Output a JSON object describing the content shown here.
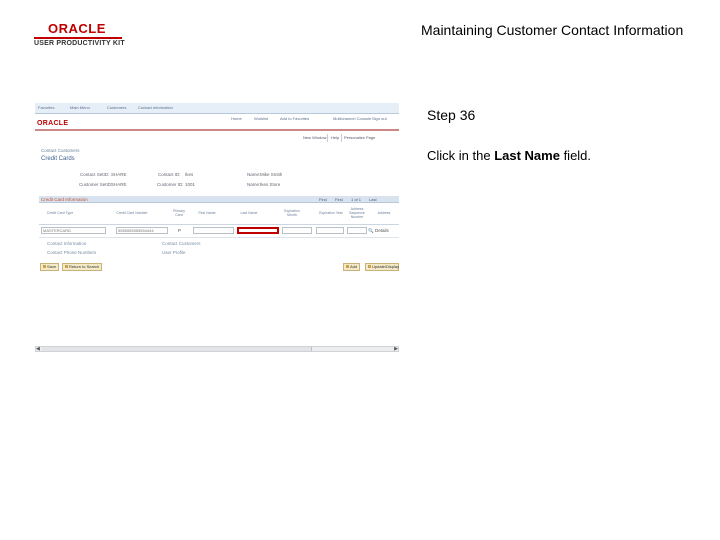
{
  "header": {
    "logo_main": "ORACLE",
    "logo_sub": "USER PRODUCTIVITY KIT",
    "title": "Maintaining Customer Contact Information"
  },
  "panel": {
    "step": "Step 36",
    "instruction_prefix": "Click in the ",
    "instruction_bold": "Last Name",
    "instruction_suffix": " field."
  },
  "screenshot": {
    "topnav": [
      "Favorites",
      "Main Menu",
      "Customers",
      "Contact Information"
    ],
    "linkbar": [
      "Home",
      "Worklist",
      "Add to Favorites",
      "Multichannel Console",
      "Sign out"
    ],
    "logo": "ORACLE",
    "page_options": [
      "New Window",
      "Help",
      "Personalize Page"
    ],
    "breadcrumb": "Contact Customers",
    "page_heading": "Credit Cards",
    "fields": [
      {
        "label": "Contact SetID:",
        "value": "SHARE"
      },
      {
        "label": "Contact ID:",
        "value": "Ikes"
      },
      {
        "label": "Name:",
        "value": "Mike Smith"
      },
      {
        "label": "Customer SetID:",
        "value": "SHARE"
      },
      {
        "label": "Customer ID:",
        "value": "1001"
      },
      {
        "label": "Name:",
        "value": "Ikes Store"
      }
    ],
    "grid": {
      "title": "Credit Card Information",
      "nav": [
        "Find",
        "First",
        "1 of 1",
        "Last"
      ],
      "columns": [
        "Credit Card Type",
        "Credit Card Number",
        "Primary Card",
        "First Name",
        "Last Name",
        "Expiration Month",
        "Expiration Year",
        "Address Sequence Number",
        "Address"
      ],
      "row": {
        "card_type": "MASTERCARD",
        "card_number": "5555555555554444",
        "primary": "P",
        "address": "Details"
      }
    },
    "links_left": [
      "Contact Information",
      "Contact Phone Numbers"
    ],
    "links_right": [
      "Contact Customers",
      "User Profile"
    ],
    "buttons": {
      "save": "Save",
      "return": "Return to Search",
      "add": "Add",
      "update": "Update/Display"
    }
  }
}
